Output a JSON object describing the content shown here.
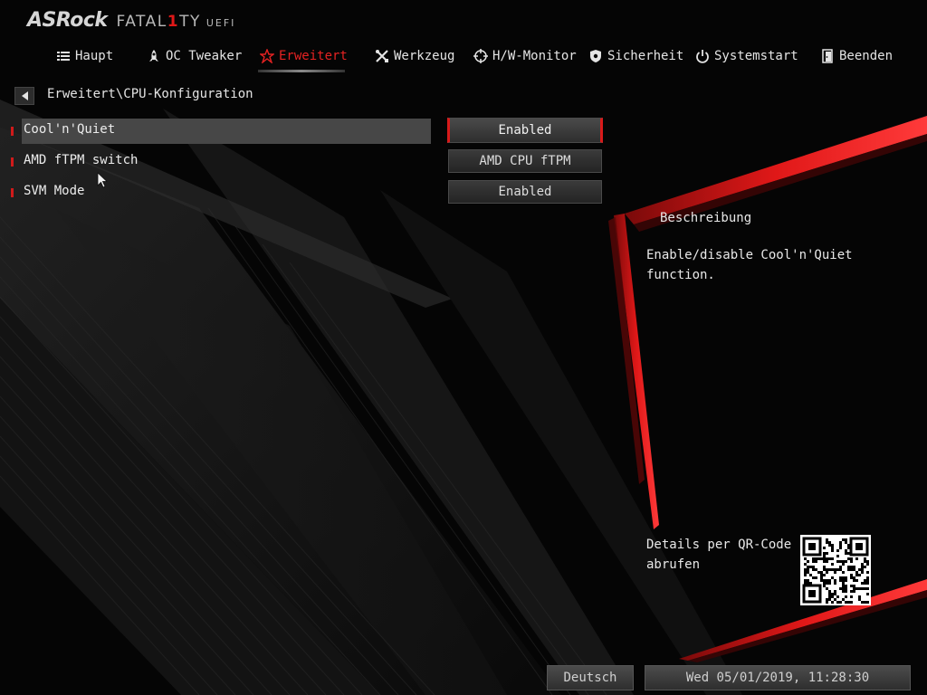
{
  "brand": {
    "logo": "ASRock",
    "product_prefix": "FATAL",
    "product_one": "1",
    "product_suffix": "TY",
    "firmware": "UEFI"
  },
  "nav": {
    "tabs": [
      {
        "label": "Haupt",
        "icon": "list-icon",
        "active": false
      },
      {
        "label": "OC Tweaker",
        "icon": "rocket-icon",
        "active": false
      },
      {
        "label": "Erweitert",
        "icon": "star-icon",
        "active": true
      },
      {
        "label": "Werkzeug",
        "icon": "tools-icon",
        "active": false
      },
      {
        "label": "H/W-Monitor",
        "icon": "crosshair-icon",
        "active": false
      },
      {
        "label": "Sicherheit",
        "icon": "shield-icon",
        "active": false
      },
      {
        "label": "Systemstart",
        "icon": "power-icon",
        "active": false
      },
      {
        "label": "Beenden",
        "icon": "exit-door-icon",
        "active": false
      }
    ]
  },
  "breadcrumb": {
    "path": "Erweitert\\CPU-Konfiguration",
    "back_icon": "back-arrow-icon"
  },
  "settings": [
    {
      "label": "Cool'n'Quiet",
      "value": "Enabled",
      "selected": true
    },
    {
      "label": "AMD fTPM switch",
      "value": "AMD CPU fTPM",
      "selected": false
    },
    {
      "label": "SVM Mode",
      "value": "Enabled",
      "selected": false
    }
  ],
  "description": {
    "title": "Beschreibung",
    "text": "Enable/disable Cool'n'Quiet function.",
    "qr_label": "Details per QR-Code abrufen",
    "qr_icon": "qr-code-icon"
  },
  "footer": {
    "language": "Deutsch",
    "datetime": "Wed 05/01/2019, 11:28:30"
  },
  "colors": {
    "accent": "#e52222",
    "background": "#050505",
    "highlight_row": "#474747",
    "text": "#e8e8e8"
  }
}
